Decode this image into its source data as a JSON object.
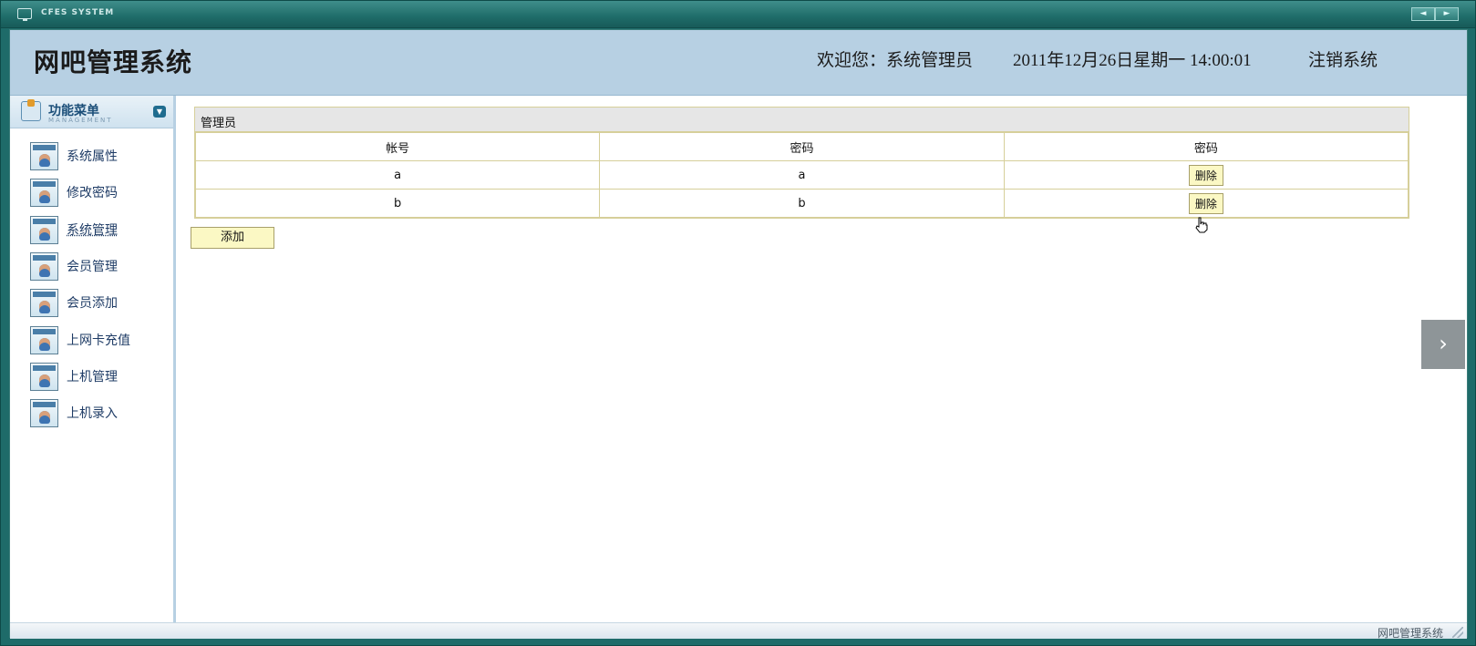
{
  "window": {
    "title": "CFES SYSTEM",
    "nav_prev": "◄",
    "nav_next": "►"
  },
  "header": {
    "brand": "网吧管理系统",
    "welcome": "欢迎您：系统管理员",
    "datetime": "2011年12月26日星期一  14:00:01",
    "logout": "注销系统"
  },
  "sidebar": {
    "menu_title": "功能菜单",
    "menu_subtitle": "MANAGEMENT",
    "items": [
      {
        "label": "系统属性"
      },
      {
        "label": "修改密码"
      },
      {
        "label": "系统管理"
      },
      {
        "label": "会员管理"
      },
      {
        "label": "会员添加"
      },
      {
        "label": "上网卡充值"
      },
      {
        "label": "上机管理"
      },
      {
        "label": "上机录入"
      }
    ]
  },
  "main": {
    "panel_title": "管理员",
    "columns": [
      "帐号",
      "密码",
      "密码"
    ],
    "rows": [
      {
        "account": "a",
        "password": "a",
        "action": "删除"
      },
      {
        "account": "b",
        "password": "b",
        "action": "删除"
      }
    ],
    "add_label": "添加"
  },
  "status": {
    "text": "网吧管理系统"
  }
}
